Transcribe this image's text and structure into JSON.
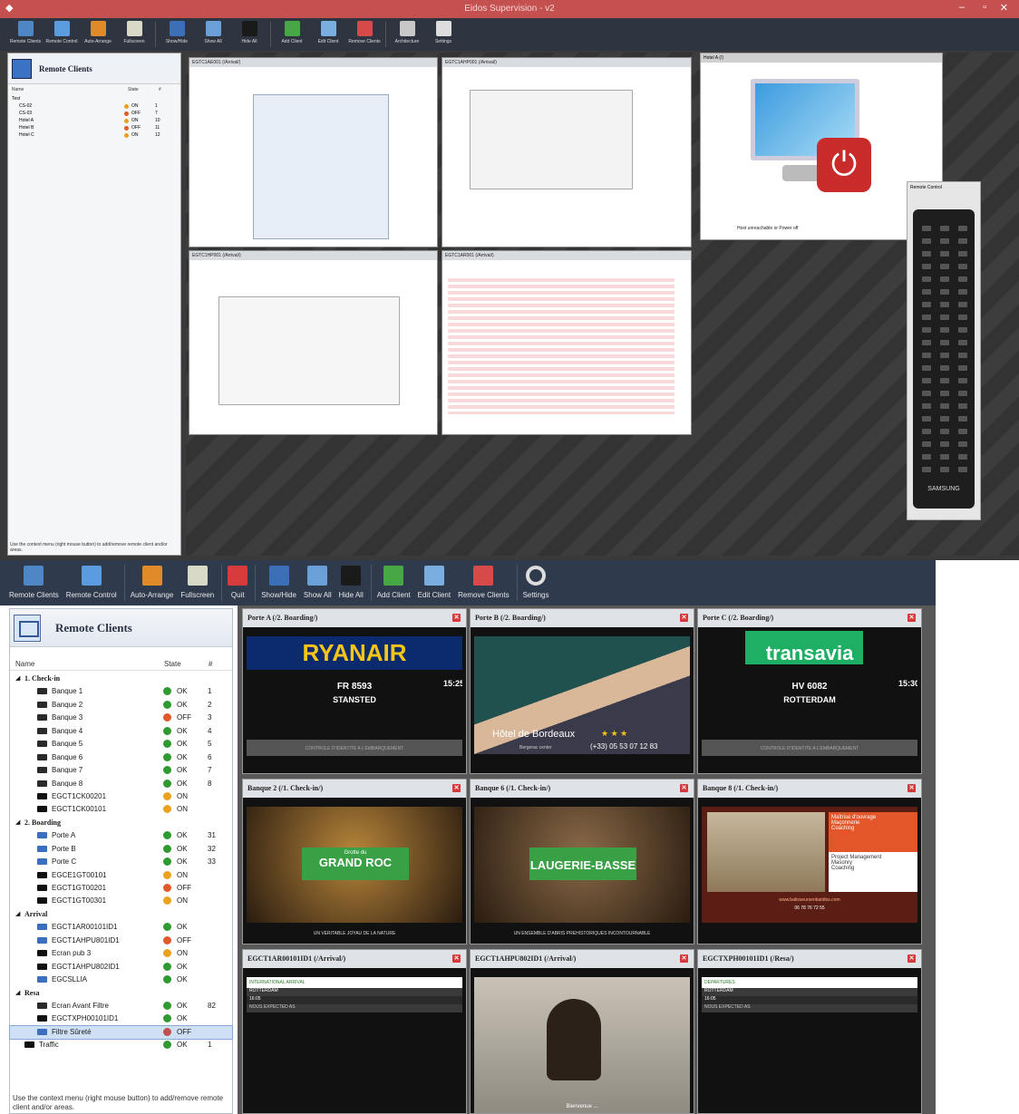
{
  "top_window": {
    "title": "Eidos Supervision - v2",
    "toolbar": [
      {
        "label": "Remote Clients",
        "icon": "monitors-icon"
      },
      {
        "label": "Remote Control",
        "icon": "monitor-icon"
      },
      {
        "label": "Auto-Arrange",
        "icon": "arrange-icon"
      },
      {
        "label": "Fullscreen",
        "icon": "fullscreen-icon"
      },
      {
        "label": "Show/Hide",
        "icon": "show-hide-icon"
      },
      {
        "label": "Show All",
        "icon": "show-all-icon"
      },
      {
        "label": "Hide All",
        "icon": "hide-all-icon"
      },
      {
        "label": "Add Client",
        "icon": "add-client-icon"
      },
      {
        "label": "Edit Client",
        "icon": "edit-client-icon"
      },
      {
        "label": "Remove Clients",
        "icon": "remove-client-icon"
      },
      {
        "label": "Architecture",
        "icon": "architecture-icon"
      },
      {
        "label": "Settings",
        "icon": "gear-icon"
      }
    ],
    "panel_title": "Remote Clients",
    "columns": {
      "name": "Name",
      "state": "State",
      "num": "#"
    },
    "rows": [
      {
        "name": "Test",
        "group": true
      },
      {
        "name": "CS-02",
        "state": "ON",
        "num": "1",
        "color": "#e8a020"
      },
      {
        "name": "CS-03",
        "state": "OFF",
        "num": "7",
        "color": "#e05a2a"
      },
      {
        "name": "Hotel A",
        "state": "ON",
        "num": "10",
        "color": "#e8a020"
      },
      {
        "name": "Hotel B",
        "state": "OFF",
        "num": "11",
        "color": "#e05a2a"
      },
      {
        "name": "Hotel C",
        "state": "ON",
        "num": "12",
        "color": "#e8a020"
      }
    ],
    "footer": "Use the context menu (right mouse button) to add/remove remote client and/or areas.",
    "windows": [
      {
        "title": "EGTC1AE001 (/Arrival/)"
      },
      {
        "title": "EGTC1AHP001 (/Arrival/)"
      },
      {
        "title": "EGTC1HP001 (/Arrival/)"
      },
      {
        "title": "EGTC1AR001 (/Arrival/)"
      }
    ],
    "power_card": {
      "title": "Hotel A (/)",
      "caption": "Host unreachable or Power off"
    },
    "remote": {
      "title": "Remote Control",
      "brand": "SAMSUNG"
    }
  },
  "toolbar": [
    {
      "label": "Remote Clients",
      "icon": "monitors-icon",
      "color": "#4f86c6"
    },
    {
      "label": "Remote Control",
      "icon": "monitor-icon",
      "color": "#5b9be0"
    },
    {
      "label": "Auto-Arrange",
      "icon": "arrange-icon",
      "color": "#e08a2a"
    },
    {
      "label": "Fullscreen",
      "icon": "fullscreen-icon",
      "color": "#d9d9c8"
    },
    {
      "label": "Quit",
      "icon": "quit-icon",
      "color": "#d83b3b"
    },
    {
      "label": "Show/Hide",
      "icon": "show-hide-icon",
      "color": "#3b6fb8"
    },
    {
      "label": "Show All",
      "icon": "show-all-icon",
      "color": "#6aa0d8"
    },
    {
      "label": "Hide All",
      "icon": "hide-all-icon",
      "color": "#1a1a1a"
    },
    {
      "label": "Add Client",
      "icon": "add-client-icon",
      "color": "#45a845"
    },
    {
      "label": "Edit Client",
      "icon": "edit-client-icon",
      "color": "#7aaee0"
    },
    {
      "label": "Remove Clients",
      "icon": "remove-client-icon",
      "color": "#d84a4a"
    },
    {
      "label": "Settings",
      "icon": "gear-icon",
      "color": "#dddddd"
    }
  ],
  "panel": {
    "title": "Remote Clients",
    "columns": {
      "name": "Name",
      "state": "State",
      "num": "#"
    },
    "footer": "Use the context menu (right mouse button) to add/remove remote client and/or areas.",
    "rows": [
      {
        "type": "group",
        "name": "1. Check-in"
      },
      {
        "type": "client",
        "name": "Banque 1",
        "state": "OK",
        "num": "1",
        "color": "#2f9a2f",
        "mon": "#2a2a2a"
      },
      {
        "type": "client",
        "name": "Banque 2",
        "state": "OK",
        "num": "2",
        "color": "#2f9a2f",
        "mon": "#2a2a2a"
      },
      {
        "type": "client",
        "name": "Banque 3",
        "state": "OFF",
        "num": "3",
        "color": "#e05a2a",
        "mon": "#2a2a2a"
      },
      {
        "type": "client",
        "name": "Banque 4",
        "state": "OK",
        "num": "4",
        "color": "#2f9a2f",
        "mon": "#2a2a2a"
      },
      {
        "type": "client",
        "name": "Banque 5",
        "state": "OK",
        "num": "5",
        "color": "#2f9a2f",
        "mon": "#2a2a2a"
      },
      {
        "type": "client",
        "name": "Banque 6",
        "state": "OK",
        "num": "6",
        "color": "#2f9a2f",
        "mon": "#2a2a2a"
      },
      {
        "type": "client",
        "name": "Banque 7",
        "state": "OK",
        "num": "7",
        "color": "#2f9a2f",
        "mon": "#2a2a2a"
      },
      {
        "type": "client",
        "name": "Banque 8",
        "state": "OK",
        "num": "8",
        "color": "#2f9a2f",
        "mon": "#2a2a2a"
      },
      {
        "type": "client",
        "name": "EGCT1CK00201",
        "state": "ON",
        "num": "",
        "color": "#eba21f",
        "mon": "#111111"
      },
      {
        "type": "client",
        "name": "EGCT1CK00101",
        "state": "ON",
        "num": "",
        "color": "#eba21f",
        "mon": "#111111"
      },
      {
        "type": "group",
        "name": "2. Boarding"
      },
      {
        "type": "client",
        "name": "Porte A",
        "state": "OK",
        "num": "31",
        "color": "#2f9a2f",
        "mon": "#3a6fc0"
      },
      {
        "type": "client",
        "name": "Porte B",
        "state": "OK",
        "num": "32",
        "color": "#2f9a2f",
        "mon": "#3a6fc0"
      },
      {
        "type": "client",
        "name": "Porte C",
        "state": "OK",
        "num": "33",
        "color": "#2f9a2f",
        "mon": "#3a6fc0"
      },
      {
        "type": "client",
        "name": "EGCE1GT00101",
        "state": "ON",
        "num": "",
        "color": "#eba21f",
        "mon": "#111111"
      },
      {
        "type": "client",
        "name": "EGCT1GT00201",
        "state": "OFF",
        "num": "",
        "color": "#e05a2a",
        "mon": "#111111"
      },
      {
        "type": "client",
        "name": "EGCT1GT00301",
        "state": "ON",
        "num": "",
        "color": "#eba21f",
        "mon": "#111111"
      },
      {
        "type": "group",
        "name": "Arrival"
      },
      {
        "type": "client",
        "name": "EGCT1AR00101ID1",
        "state": "OK",
        "num": "",
        "color": "#2f9a2f",
        "mon": "#3a6fc0"
      },
      {
        "type": "client",
        "name": "EGCT1AHPU801ID1",
        "state": "OFF",
        "num": "",
        "color": "#e05a2a",
        "mon": "#3a6fc0"
      },
      {
        "type": "client",
        "name": "Ecran pub 3",
        "state": "ON",
        "num": "",
        "color": "#eba21f",
        "mon": "#111111"
      },
      {
        "type": "client",
        "name": "EGCT1AHPU802ID1",
        "state": "OK",
        "num": "",
        "color": "#2f9a2f",
        "mon": "#111111"
      },
      {
        "type": "client",
        "name": "EGCSLLIA",
        "state": "OK",
        "num": "",
        "color": "#2f9a2f",
        "mon": "#3a6fc0"
      },
      {
        "type": "group",
        "name": "Resa"
      },
      {
        "type": "client",
        "name": "Ecran Avant Filtre",
        "state": "OK",
        "num": "82",
        "color": "#2f9a2f",
        "mon": "#2a2a2a"
      },
      {
        "type": "client",
        "name": "EGCTXPH00101ID1",
        "state": "OK",
        "num": "",
        "color": "#2f9a2f",
        "mon": "#111111"
      },
      {
        "type": "client",
        "name": "Filtre Sûreté",
        "state": "OFF",
        "num": "",
        "color": "#c0504d",
        "mon": "#3a6fc0",
        "selected": true
      },
      {
        "type": "toplevel",
        "name": "Traffic",
        "state": "OK",
        "num": "1",
        "color": "#2f9a2f",
        "mon": "#111111"
      }
    ]
  },
  "cells": [
    {
      "title": "Porte A (/2. Boarding/)",
      "kind": "flight",
      "brand": "RYANAIR",
      "brand_bg": "#0c2a6e",
      "brand_color": "#f5c518",
      "flight": "FR 8593",
      "dest": "STANSTED",
      "time": "15:25",
      "control": "CONTROLE D'IDENTITE A L'EMBARQUEMENT"
    },
    {
      "title": "Porte B (/2. Boarding/)",
      "kind": "hotel",
      "name": "Hôtel de Bordeaux",
      "stars": "★ ★ ★",
      "phone": "(+33) 05 53 07 12 83",
      "sub": "Bergerac center"
    },
    {
      "title": "Porte C (/2. Boarding/)",
      "kind": "flight",
      "brand": "transavia",
      "brand_bg": "#ffffff",
      "brand_color": "#ffffff",
      "flight": "HV 6082",
      "dest": "ROTTERDAM",
      "time": "15:30",
      "control": "CONTROLE D'IDENTITE A L'EMBARQUEMENT"
    },
    {
      "title": "Banque 2 (/1. Check-in/)",
      "kind": "ad",
      "small": "Grotte du",
      "big": "GRAND ROC",
      "tag": "UN VERITABLE JOYAU DE LA NATURE",
      "bg": "#b8853a"
    },
    {
      "title": "Banque 6 (/1. Check-in/)",
      "kind": "ad",
      "small": "",
      "big": "LAUGERIE-BASSE",
      "tag": "UN ENSEMBLE D'ABRIS PREHISTORIQUES INCONTOURNABLE",
      "bg": "#8a6a48"
    },
    {
      "title": "Banque 8 (/1. Check-in/)",
      "kind": "promo",
      "items": [
        "Maîtrise d'ouvrage",
        "Maçonnerie",
        "Coaching"
      ],
      "items2": [
        "Project Management",
        "Masonry",
        "Coaching"
      ],
      "phone": "06 78 76 72 55",
      "site": "www.batisseursenbatidos.com"
    },
    {
      "title": "EGCT1AR00101ID1 (/Arrival/)",
      "kind": "ops",
      "head": "INTERNATIONAL ARRIVAL",
      "r1": "ROTTERDAM",
      "r2": "16:05",
      "r3": "NOUS EXPECTED AS"
    },
    {
      "title": "EGCT1AHPU802ID1 (/Arrival/)",
      "kind": "cat",
      "caption": "Bienvenue ..."
    },
    {
      "title": "EGCTXPH00101ID1 (/Resa/)",
      "kind": "ops",
      "head": "DEPARTURES",
      "r1": "ROTTERDAM",
      "r2": "16:05",
      "r3": "NOUS EXPECTED AS"
    }
  ]
}
